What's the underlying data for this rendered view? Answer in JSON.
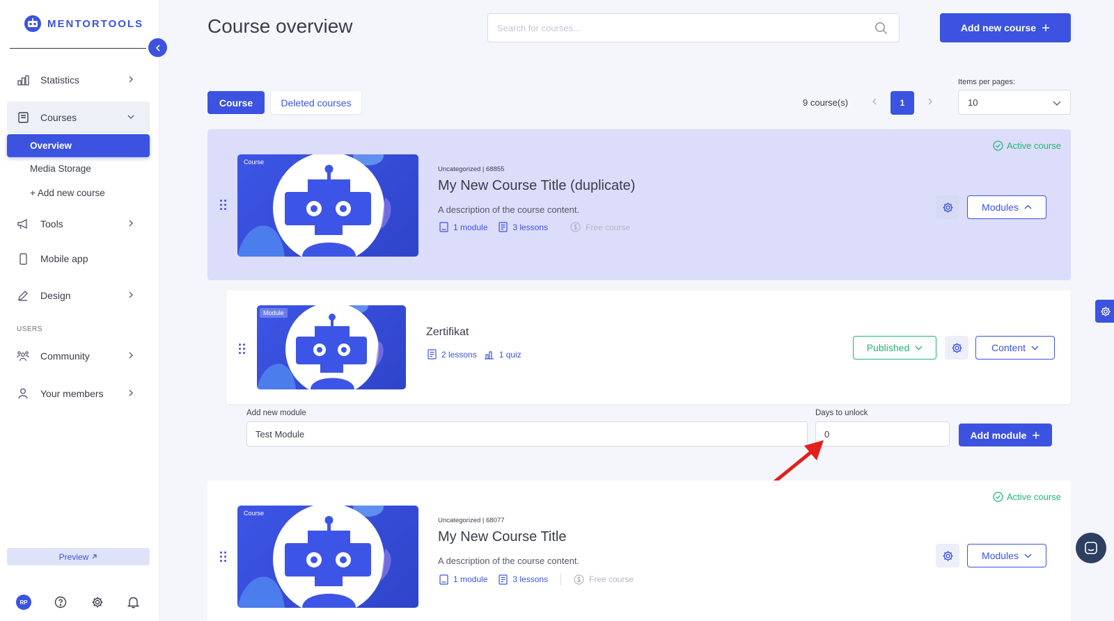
{
  "app": {
    "logo_text": "MENTORTOOLS",
    "accent": "#3b53e0",
    "success": "#22b573"
  },
  "sidebar": {
    "items": [
      {
        "label": "Statistics",
        "icon": "bar-chart-icon"
      },
      {
        "label": "Courses",
        "icon": "book-icon"
      },
      {
        "label": "Tools",
        "icon": "megaphone-icon"
      },
      {
        "label": "Mobile app",
        "icon": "mobile-icon"
      },
      {
        "label": "Design",
        "icon": "pencil-icon"
      },
      {
        "label": "Community",
        "icon": "community-icon"
      },
      {
        "label": "Your members",
        "icon": "user-icon"
      }
    ],
    "sub_items": [
      "Overview",
      "Media Storage",
      "+ Add new course"
    ],
    "users_section": "USERS",
    "preview_label": "Preview",
    "avatar_initials": "RP"
  },
  "header": {
    "title": "Course overview",
    "search_placeholder": "Search for courses...",
    "add_course_label": "Add new course"
  },
  "toolbar": {
    "tab_course": "Course",
    "tab_deleted": "Deleted courses",
    "count_label": "9 course(s)",
    "current_page": "1",
    "items_per_page_label": "Items per pages:",
    "items_per_page_value": "10"
  },
  "courses": [
    {
      "tag": "Course",
      "meta": "Uncategorized | 68855",
      "title": "My New Course Title (duplicate)",
      "description": "A description of the course content.",
      "modules": "1 module",
      "lessons": "3 lessons",
      "price": "Free course",
      "status": "Active course",
      "modules_button": "Modules"
    },
    {
      "tag": "Course",
      "meta": "Uncategorized | 68077",
      "title": "My New Course Title",
      "description": "A description of the course content.",
      "modules": "1 module",
      "lessons": "3 lessons",
      "price": "Free course",
      "status": "Active course",
      "modules_button": "Modules"
    }
  ],
  "module": {
    "tag": "Module",
    "title": "Zertifikat",
    "lessons": "2 lessons",
    "quiz": "1 quiz",
    "status_button": "Published",
    "content_button": "Content"
  },
  "add_module": {
    "name_label": "Add new module",
    "name_value": "Test Module",
    "days_label": "Days to unlock",
    "days_value": "0",
    "button_label": "Add module"
  }
}
